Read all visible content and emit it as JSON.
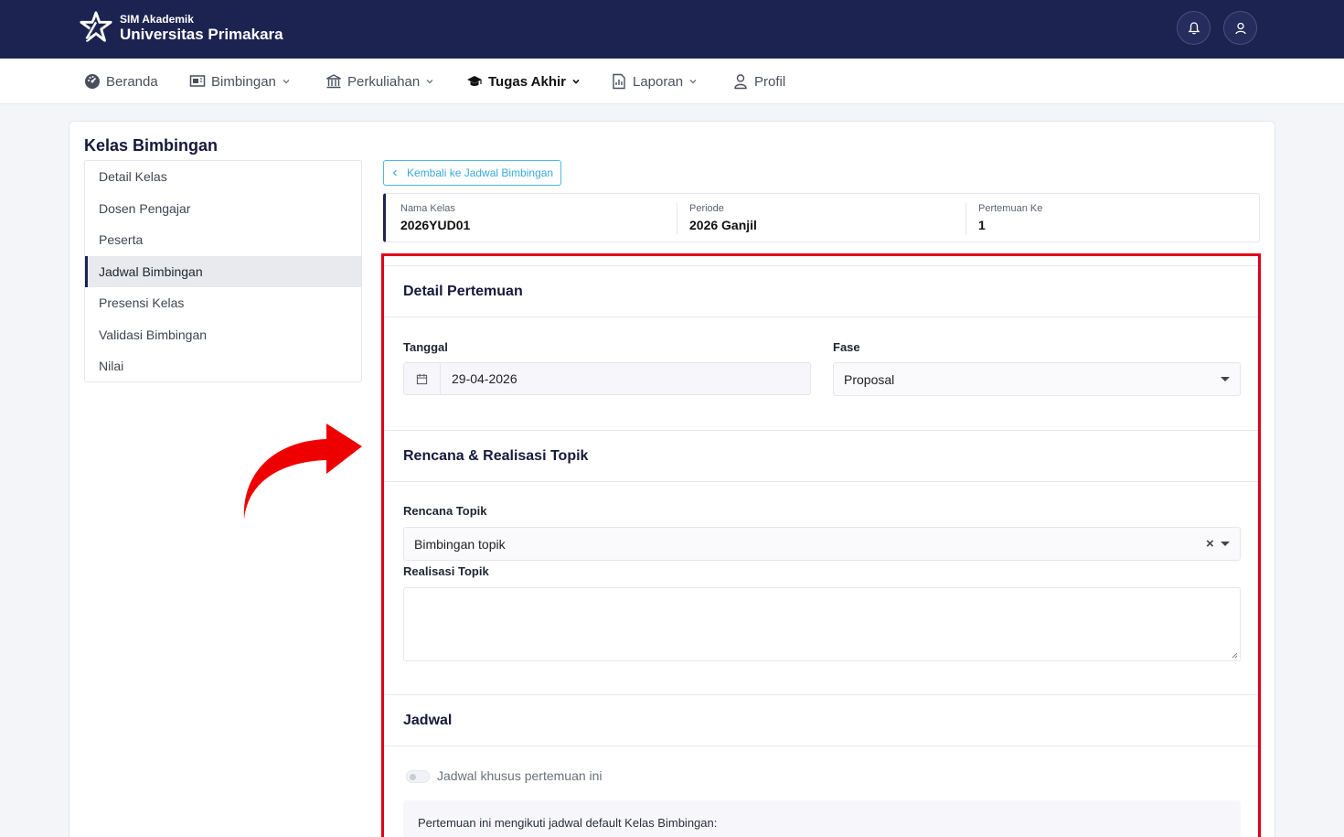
{
  "header": {
    "subtitle": "SIM Akademik",
    "title": "Universitas Primakara"
  },
  "nav": {
    "items": [
      {
        "label": "Beranda",
        "icon": "dashboard-icon"
      },
      {
        "label": "Bimbingan",
        "icon": "classroom-icon"
      },
      {
        "label": "Perkuliahan",
        "icon": "building-icon"
      },
      {
        "label": "Tugas Akhir",
        "icon": "graduation-cap-icon"
      },
      {
        "label": "Laporan",
        "icon": "report-icon"
      },
      {
        "label": "Profil",
        "icon": "user-icon"
      }
    ]
  },
  "page": {
    "title": "Kelas Bimbingan",
    "back_label": "Kembali ke Jadwal Bimbingan"
  },
  "sidebar": {
    "items": [
      {
        "label": "Detail Kelas"
      },
      {
        "label": "Dosen Pengajar"
      },
      {
        "label": "Peserta"
      },
      {
        "label": "Jadwal Bimbingan"
      },
      {
        "label": "Presensi Kelas"
      },
      {
        "label": "Validasi Bimbingan"
      },
      {
        "label": "Nilai"
      }
    ],
    "active": "Jadwal Bimbingan"
  },
  "info": {
    "nama_kelas_label": "Nama Kelas",
    "nama_kelas": "2026YUD01",
    "periode_label": "Periode",
    "periode": "2026 Ganjil",
    "pertemuan_label": "Pertemuan Ke",
    "pertemuan": "1"
  },
  "form": {
    "detail_title": "Detail Pertemuan",
    "tanggal_label": "Tanggal",
    "tanggal_value": "29-04-2026",
    "fase_label": "Fase",
    "fase_value": "Proposal",
    "topik_title": "Rencana & Realisasi Topik",
    "rencana_label": "Rencana Topik",
    "rencana_value": "Bimbingan topik",
    "realisasi_label": "Realisasi Topik",
    "realisasi_value": "",
    "jadwal_title": "Jadwal",
    "toggle_label": "Jadwal khusus pertemuan ini",
    "note": "Pertemuan ini mengikuti jadwal default Kelas Bimbingan:"
  },
  "colors": {
    "header_bg": "#1c2350",
    "highlight": "#e0001b",
    "accent": "#3aa9d9"
  }
}
